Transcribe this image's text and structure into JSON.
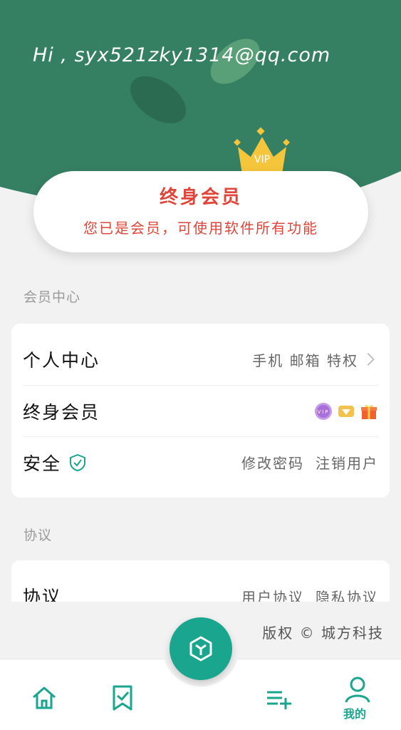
{
  "header": {
    "greeting": "Hi ,  syx521zky1314@qq.com",
    "crown_text": "VIP",
    "colors": {
      "header_bg": "#357f62",
      "leaf_dark": "#2b6b52",
      "leaf_light": "#5fa47d",
      "crown": "#f5c53b"
    }
  },
  "membership": {
    "title": "终身会员",
    "subtitle": "您已是会员，可使用软件所有功能",
    "accent": "#e0453a"
  },
  "member_center": {
    "section_label": "会员中心",
    "rows": [
      {
        "label": "个人中心",
        "right": [
          "手机 邮箱 特权"
        ],
        "icon": "chevron-right-icon"
      },
      {
        "label": "终身会员",
        "right": [],
        "badges": [
          "vip-badge-icon",
          "diamond-icon",
          "gift-icon"
        ]
      },
      {
        "label": "安全",
        "label_icon": "shield-check-icon",
        "right": [
          "修改密码",
          "注销用户"
        ]
      }
    ]
  },
  "agreement": {
    "section_label": "协议",
    "rows": [
      {
        "label": "协议",
        "right": [
          "用户协议",
          "隐私协议"
        ]
      }
    ]
  },
  "footer": {
    "copyright": "版权 © 城方科技"
  },
  "bottom_nav": {
    "items": [
      {
        "name": "home",
        "icon": "home-icon"
      },
      {
        "name": "bookmark",
        "icon": "bookmark-check-icon"
      },
      {
        "name": "center",
        "icon": "cube-icon"
      },
      {
        "name": "playlist-add",
        "icon": "playlist-add-icon"
      },
      {
        "name": "mine",
        "icon": "user-icon",
        "label": "我的",
        "active": true
      }
    ],
    "accent": "#1aa58f"
  }
}
